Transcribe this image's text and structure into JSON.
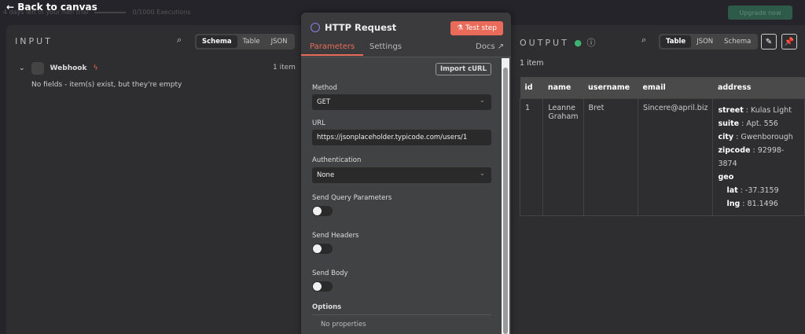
{
  "topbar": {
    "back": "Back to canvas",
    "trial": "4 days left in your n8n trial",
    "executions": "0/1000 Executions",
    "upgrade": "Upgrade now"
  },
  "input": {
    "title": "INPUT",
    "tabs": [
      "Schema",
      "Table",
      "JSON"
    ],
    "node": "Webhook",
    "count": "1 item",
    "empty": "No fields - item(s) exist, but they're empty"
  },
  "node": {
    "title": "HTTP Request",
    "test": "Test step",
    "tabs": [
      "Parameters",
      "Settings"
    ],
    "docs": "Docs",
    "import": "Import cURL",
    "method_label": "Method",
    "method": "GET",
    "url_label": "URL",
    "url": "https://jsonplaceholder.typicode.com/users/1",
    "auth_label": "Authentication",
    "auth": "None",
    "query": "Send Query Parameters",
    "headers": "Send Headers",
    "body": "Send Body",
    "options": "Options",
    "no_props": "No properties"
  },
  "output": {
    "title": "OUTPUT",
    "tabs": [
      "Table",
      "JSON",
      "Schema"
    ],
    "count": "1 item",
    "columns": [
      "id",
      "name",
      "username",
      "email",
      "address"
    ],
    "row": {
      "id": "1",
      "name": "Leanne Graham",
      "username": "Bret",
      "email": "Sincere@april.biz",
      "address": [
        [
          "street",
          "Kulas Light"
        ],
        [
          "suite",
          "Apt. 556"
        ],
        [
          "city",
          "Gwenborough"
        ],
        [
          "zipcode",
          "92998-3874"
        ]
      ],
      "geo_label": "geo",
      "geo": [
        [
          "lat",
          "-37.3159"
        ],
        [
          "lng",
          "81.1496"
        ]
      ]
    }
  }
}
